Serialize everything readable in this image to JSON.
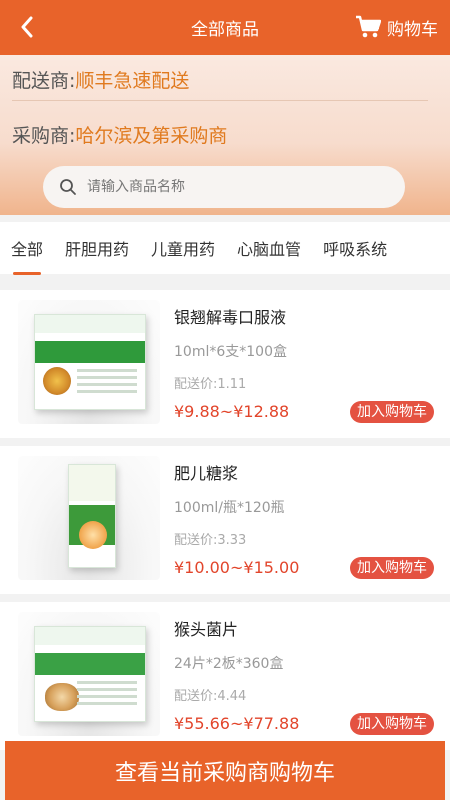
{
  "header": {
    "back_icon": "chevron-left-icon",
    "title": "全部商品",
    "cart_icon": "shopping-cart-icon",
    "cart_label": "购物车"
  },
  "info": {
    "distributor_label": "配送商:",
    "distributor_value": "顺丰急速配送",
    "purchaser_label": "采购商:",
    "purchaser_value": "哈尔滨及第采购商"
  },
  "search": {
    "icon": "search-icon",
    "placeholder": "请输入商品名称"
  },
  "tabs": [
    {
      "label": "全部",
      "active": true
    },
    {
      "label": "肝胆用药"
    },
    {
      "label": "儿童用药"
    },
    {
      "label": "心脑血管"
    },
    {
      "label": "呼吸系统"
    }
  ],
  "products": [
    {
      "name": "银翘解毒口服液",
      "spec": "10ml*6支*100盒",
      "ship_price": "配送价:1.11",
      "price_range": "¥9.88~¥12.88",
      "add_label": "加入购物车"
    },
    {
      "name": "肥儿糖浆",
      "spec": "100ml/瓶*120瓶",
      "ship_price": "配送价:3.33",
      "price_range": "¥10.00~¥15.00",
      "add_label": "加入购物车"
    },
    {
      "name": "猴头菌片",
      "spec": "24片*2板*360盒",
      "ship_price": "配送价:4.44",
      "price_range": "¥55.66~¥77.88",
      "add_label": "加入购物车"
    }
  ],
  "bottom": {
    "label": "查看当前采购商购物车"
  },
  "colors": {
    "accent": "#e8632a",
    "price": "#e2452b",
    "highlight": "#e07a1f"
  }
}
